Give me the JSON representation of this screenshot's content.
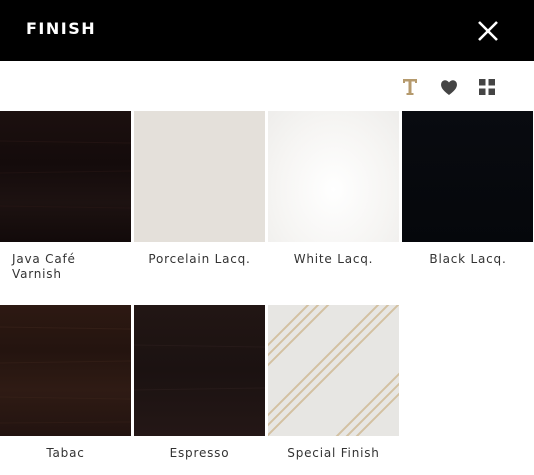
{
  "header": {
    "title": "FINISH",
    "close_icon": "close-icon",
    "background_color": "#000000"
  },
  "toolbar": {
    "icons": [
      "text-format-icon",
      "heart-icon",
      "grid-view-icon"
    ],
    "text_icon_color": "#b59a6d",
    "icon_color": "#444444"
  },
  "swatches": [
    {
      "label": "Java Café\nVarnish",
      "color": "#1a0f0e"
    },
    {
      "label": "Porcelain Lacq.",
      "color": "#e4e0da"
    },
    {
      "label": "White Lacq.",
      "color": "#f6f5f3"
    },
    {
      "label": "Black Lacq.",
      "color": "#06080d"
    },
    {
      "label": "Tabac",
      "color": "#2a1711"
    },
    {
      "label": "Espresso",
      "color": "#201513"
    },
    {
      "label": "Special Finish",
      "color": "#e7e6e3"
    }
  ]
}
